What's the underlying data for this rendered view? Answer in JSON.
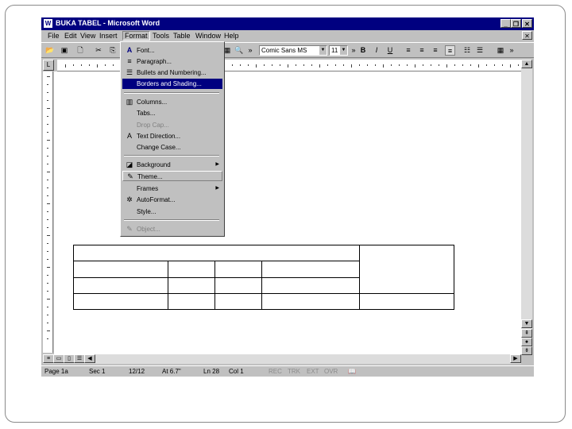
{
  "window": {
    "title": "BUKA TABEL - Microsoft Word"
  },
  "menubar": [
    "File",
    "Edit",
    "View",
    "Insert",
    "Format",
    "Tools",
    "Table",
    "Window",
    "Help"
  ],
  "toolbar": {
    "font_name": "Comic Sans MS",
    "font_size": "11"
  },
  "format_menu": [
    {
      "label": "Font...",
      "icon": "A"
    },
    {
      "label": "Paragraph...",
      "icon": "≡"
    },
    {
      "label": "Bullets and Numbering...",
      "icon": "☰"
    },
    {
      "label": "Borders and Shading..."
    },
    {
      "label": "Columns...",
      "icon": "▥"
    },
    {
      "label": "Tabs..."
    },
    {
      "label": "Drop Cap..."
    },
    {
      "label": "Text Direction...",
      "icon": "A"
    },
    {
      "label": "Change Case..."
    },
    {
      "label": "Background",
      "icon": "◪"
    },
    {
      "label": "Theme...",
      "icon": "✎"
    },
    {
      "label": "Frames"
    },
    {
      "label": "AutoFormat...",
      "icon": "✲"
    },
    {
      "label": "Style..."
    },
    {
      "label": "Object...",
      "icon": "✎"
    }
  ],
  "statusbar": {
    "page": "Page 1a",
    "sec": "Sec 1",
    "pages": "12/12",
    "at": "At 6.7\"",
    "ln": "Ln 28",
    "col": "Col 1",
    "rec": "REC",
    "trk": "TRK",
    "ext": "EXT",
    "ovr": "OVR"
  }
}
